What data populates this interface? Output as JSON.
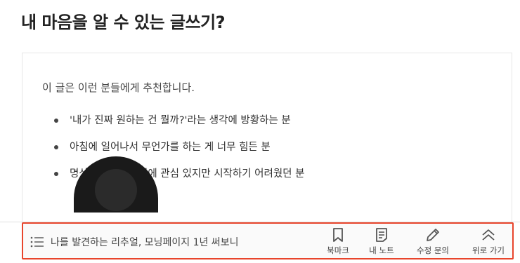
{
  "page": {
    "title": "내 마음을 알 수 있는 글쓰기?"
  },
  "card": {
    "intro": "이 글은 이런 분들에게 추천합니다.",
    "recommendations": [
      "'내가 진짜 원하는 건 뭘까?'라는 생각에 방황하는 분",
      "아침에 일어나서 무언가를 하는 게 너무 힘든 분",
      "명상이나 마음챙김에 관심 있지만 시작하기 어려웠던 분"
    ]
  },
  "bottom_bar": {
    "toc_icon": "list-icon",
    "toc_title": "나를 발견하는 리추얼, 모닝페이지 1년 써보니",
    "actions": [
      {
        "icon": "bookmark-icon",
        "label": "북마크"
      },
      {
        "icon": "note-icon",
        "label": "내 노트"
      },
      {
        "icon": "pencil-icon",
        "label": "수정 문의"
      },
      {
        "icon": "double-chevron-up-icon",
        "label": "위로 가기"
      }
    ],
    "highlight_color": "#e8452c"
  }
}
